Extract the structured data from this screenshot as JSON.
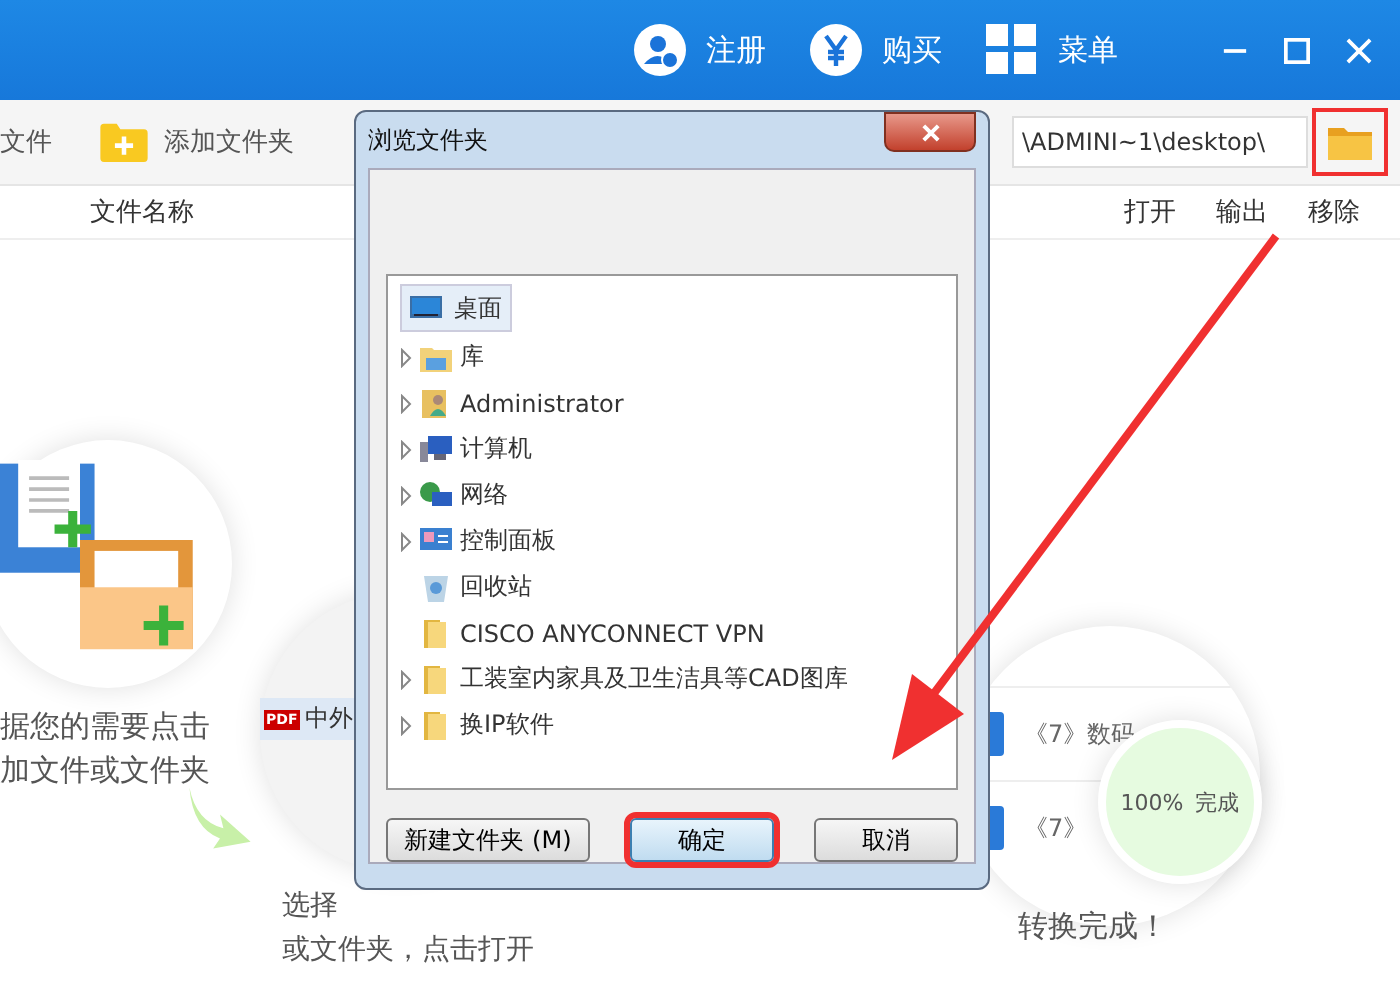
{
  "header": {
    "actions": [
      {
        "kind": "user",
        "label": "注册"
      },
      {
        "kind": "yen",
        "label": "购买"
      },
      {
        "kind": "grid",
        "label": "菜单"
      }
    ]
  },
  "toolbar": {
    "add_file": "文件",
    "add_folder": "添加文件夹",
    "path": "\\ADMINI~1\\desktop\\",
    "browse_highlighted": true
  },
  "columns": {
    "name": "文件名称",
    "actions": [
      "打开",
      "输出",
      "移除"
    ]
  },
  "steps": [
    {
      "lines": [
        "据您的需要点击",
        "加文件或文件夹"
      ]
    },
    {
      "file": "中外",
      "file_badge": "PDF",
      "lines": [
        "选择",
        "或文件夹，点击打开"
      ]
    },
    {
      "rows": [
        "《7》数码",
        "《7》"
      ],
      "progress": "100%",
      "status": "完成",
      "lines": [
        "转换完成！"
      ]
    }
  ],
  "dialog": {
    "title": "浏览文件夹",
    "root": {
      "label": "桌面",
      "kind": "desktop",
      "selected": true
    },
    "items": [
      {
        "label": "库",
        "kind": "library",
        "expandable": true
      },
      {
        "label": "Administrator",
        "kind": "user",
        "expandable": true
      },
      {
        "label": "计算机",
        "kind": "computer",
        "expandable": true
      },
      {
        "label": "网络",
        "kind": "network",
        "expandable": true
      },
      {
        "label": "控制面板",
        "kind": "control-panel",
        "expandable": true
      },
      {
        "label": "回收站",
        "kind": "recycle-bin",
        "expandable": false
      },
      {
        "label": "CISCO ANYCONNECT VPN",
        "kind": "folder",
        "expandable": false
      },
      {
        "label": "工装室内家具及卫生洁具等CAD图库",
        "kind": "folder",
        "expandable": true
      },
      {
        "label": "换IP软件",
        "kind": "folder",
        "expandable": true
      }
    ],
    "buttons": [
      {
        "label": "新建文件夹 (M)",
        "highlighted": false
      },
      {
        "label": "确定",
        "highlighted": true
      },
      {
        "label": "取消",
        "highlighted": false
      }
    ]
  }
}
